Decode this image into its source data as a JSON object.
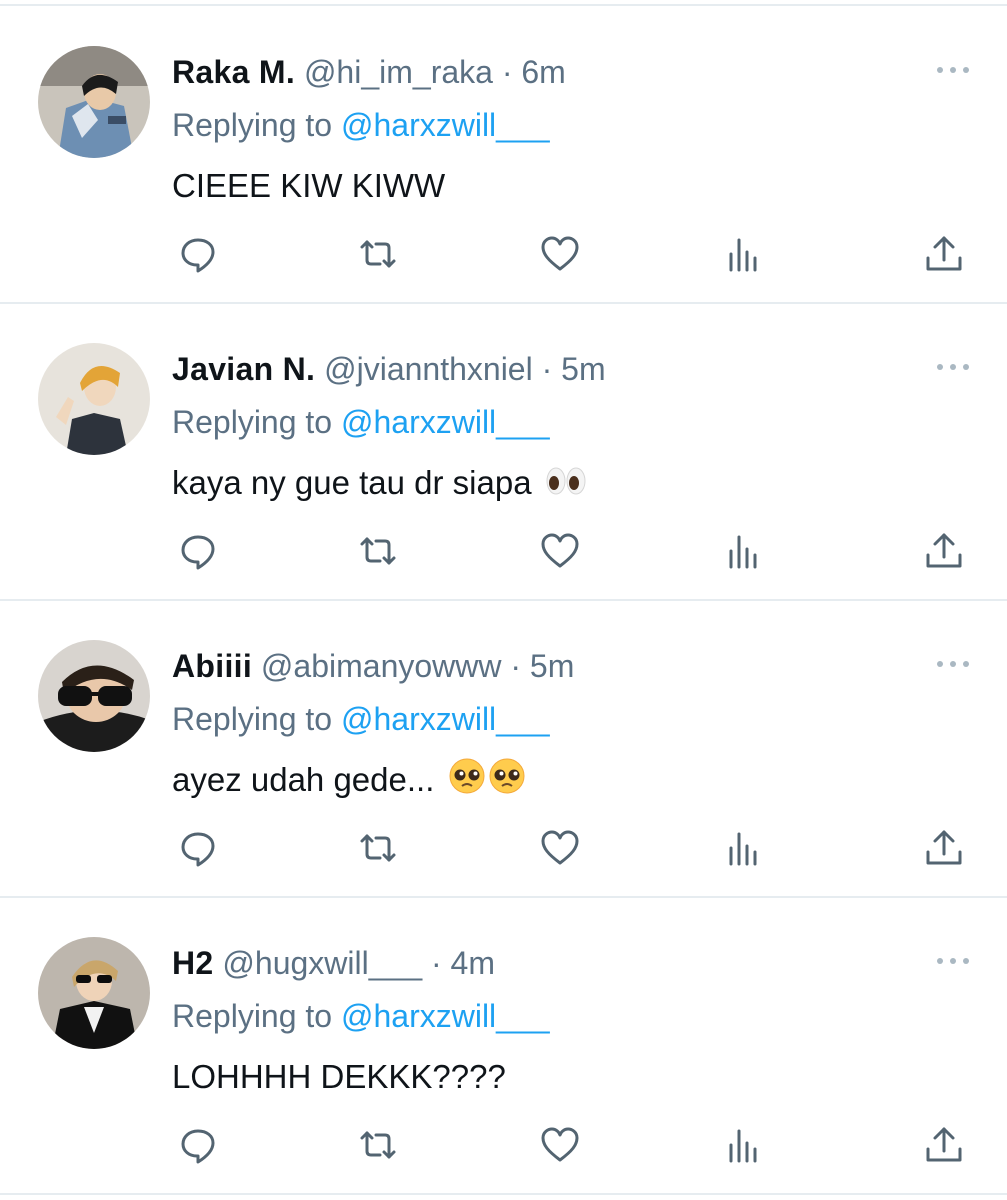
{
  "replying_prefix": "Replying to",
  "tweets": [
    {
      "name": "Raka M.",
      "handle": "@hi_im_raka",
      "separator": "·",
      "time": "6m",
      "mention": "@harxzwill___",
      "text": "CIEEE KIW KIWW",
      "emoji": ""
    },
    {
      "name": "Javian N.",
      "handle": "@jviannthxniel",
      "separator": "·",
      "time": "5m",
      "mention": "@harxzwill___",
      "text": "kaya ny gue tau dr siapa",
      "emoji": "eyes"
    },
    {
      "name": "Abiiii",
      "handle": "@abimanyowww",
      "separator": "·",
      "time": "5m",
      "mention": "@harxzwill___",
      "text": "ayez udah gede...",
      "emoji": "pleading-face x2"
    },
    {
      "name": "H2",
      "handle": "@hugxwill___",
      "separator": "·",
      "time": "4m",
      "mention": "@harxzwill___",
      "text": "LOHHHH DEKKK????",
      "emoji": ""
    }
  ],
  "icons": {
    "reply": "comment-icon",
    "retweet": "retweet-icon",
    "like": "heart-icon",
    "analytics": "analytics-icon",
    "share": "share-icon",
    "more": "more-icon"
  },
  "colors": {
    "name": "#0f1419",
    "secondary": "#5b7083",
    "mention": "#1da1f2",
    "icon": "#536471",
    "divider": "#e6ecf0"
  }
}
